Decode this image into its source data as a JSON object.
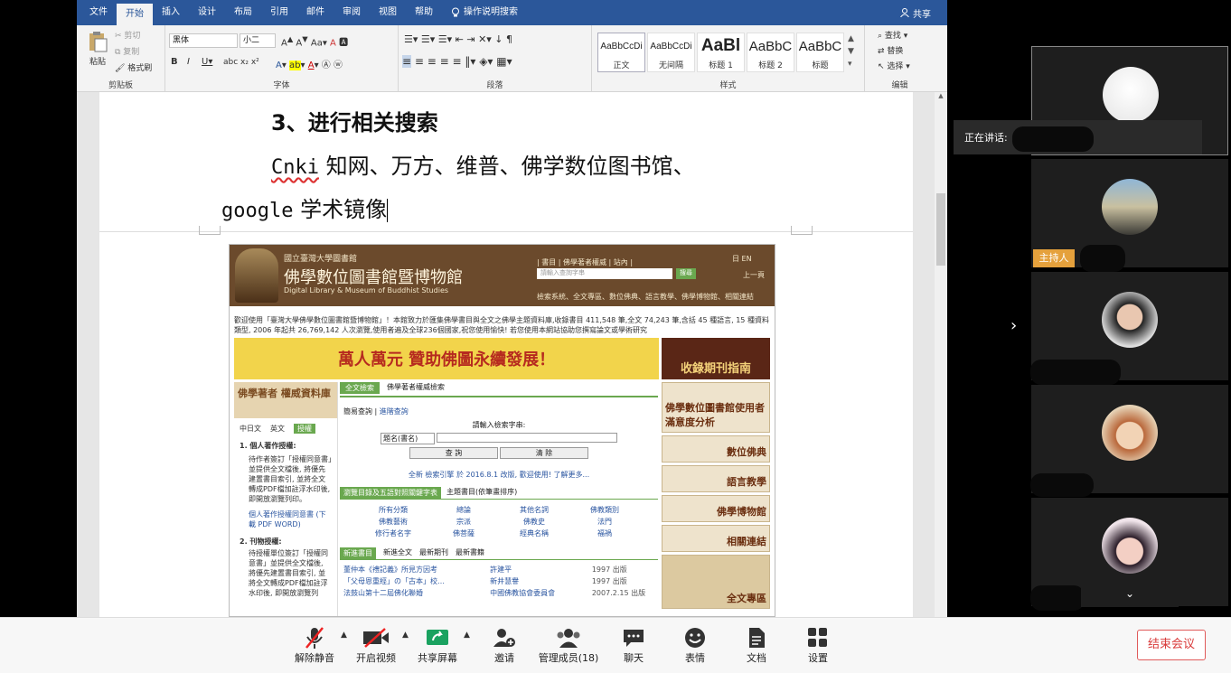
{
  "word": {
    "tabs": [
      "文件",
      "开始",
      "插入",
      "设计",
      "布局",
      "引用",
      "邮件",
      "审阅",
      "视图",
      "帮助"
    ],
    "active_tab": "开始",
    "tell_me": "操作说明搜索",
    "share": "共享",
    "clipboard": {
      "paste": "粘贴",
      "cut": "剪切",
      "copy": "复制",
      "format_painter": "格式刷",
      "label": "剪贴板"
    },
    "font": {
      "name": "黑体",
      "size": "小二",
      "label": "字体"
    },
    "paragraph_label": "段落",
    "styles": {
      "label": "样式",
      "items": [
        {
          "preview": "AaBbCcDi",
          "name": "正文"
        },
        {
          "preview": "AaBbCcDi",
          "name": "无间隔"
        },
        {
          "preview": "AaBl",
          "name": "标题 1"
        },
        {
          "preview": "AaBbC",
          "name": "标题 2"
        },
        {
          "preview": "AaBbC",
          "name": "标题"
        }
      ]
    },
    "editing": {
      "find": "查找",
      "replace": "替换",
      "select": "选择",
      "label": "编辑"
    }
  },
  "doc": {
    "line1": "3、进行相关搜索",
    "line2_a": "Cnki",
    "line2_b": "知网、万方、维普、佛学数位图书馆、",
    "line3_a": "google",
    "line3_b": "学术镜像"
  },
  "embedded": {
    "site_title": "佛學數位圖書館暨博物館",
    "site_sub_cn": "國立臺灣大學圖書館",
    "site_sub_en": "Digital Library & Museum of Buddhist Studies",
    "top_links": "| 書目 | 佛學著者權威 | 站內 |",
    "search_placeholder": "請輸入查詢字串",
    "search_btn": "搜尋",
    "prev": "上一頁",
    "lang": [
      "日",
      "EN"
    ],
    "nav": "檢索系統、全文專區、數位佛典、語言教學、佛學博物館、相關連結",
    "notice": "歡迎使用「臺灣大學佛學數位圖書館暨博物館」！本館致力於匯集佛學書目與全文之佛學主題資料庫,收錄書目 411,548 筆,全文 74,243 筆,含括 45 種語言, 15 種資料類型, 2006 年起共 26,769,142 人次瀏覽,使用者遍及全球236個國家,祝您使用愉快! 若您使用本網站協助您撰寫論文或學術研究",
    "banner": "萬人萬元 贊助佛圖永續發展！",
    "banner_right": "收錄期刊指南",
    "left_title": "佛學著者 權威資料庫",
    "left_tabs": [
      "中日文",
      "英文",
      "授權"
    ],
    "left_h1": "1. 個人著作授權:",
    "left_p1": "待作者簽訂「授權同意書」並提供全文檔後, 將優先建置書目索引, 並將全文轉成PDF檔加註浮水印後, 即開放瀏覽列印。",
    "left_link": "個人著作授權同意書 (下載 PDF WORD)",
    "left_h2": "2. 刊物授權:",
    "left_p2": "待授權單位簽訂「授權同意書」並提供全文檔後, 將優先建置書目索引, 並將全文轉成PDF檔加註浮水印後, 即開放瀏覽列",
    "mid_tabs": [
      "全文檢索",
      "佛學著者權威檢索"
    ],
    "mid_query": [
      "簡易查詢",
      "進階查詢"
    ],
    "mid_prompt": "請輸入檢索字串:",
    "mid_field": "題名(書名)",
    "mid_btns": [
      "查 詢",
      "清 除"
    ],
    "mid_new": "全新 檢索引擎 於 2016.8.1 改版, 歡迎使用! 了解更多...",
    "mid_tabs2": [
      "瀏覽目錄及五語對照關鍵字表",
      "主題書目(依筆畫排序)"
    ],
    "mid_cats": [
      "所有分類",
      "總論",
      "其他名詞",
      "佛教類別",
      "佛教藝術",
      "宗派",
      "佛教史",
      "法門",
      "修行者名字",
      "佛菩薩",
      "經典名稱",
      "福禍"
    ],
    "mid_tabs3": [
      "新進書目",
      "新進全文",
      "最新期刊",
      "最新書籍"
    ],
    "mid_rows": [
      {
        "t": "董仲本《禮記義》所見方因考",
        "a": "許建平",
        "y": "1997 出版"
      },
      {
        "t": "「父母恩重經」の「古本」校…",
        "a": "新井慧譽",
        "y": "1997 出版"
      },
      {
        "t": "法鼓山第十二屆佛化聯婚",
        "a": "中國佛教協會委員會",
        "y": "2007.2.15 出版"
      }
    ],
    "right_boxes": [
      "佛學數位圖書館使用者滿意度分析",
      "數位佛典",
      "語言教學",
      "佛學博物館",
      "相關連結",
      "全文專區"
    ]
  },
  "zoom": {
    "speaking": "正在讲话: ",
    "host_badge": "主持人",
    "toolbar": [
      {
        "icon": "mic-muted-icon",
        "label": "解除静音"
      },
      {
        "icon": "video-off-icon",
        "label": "开启视频"
      },
      {
        "icon": "share-screen-icon",
        "label": "共享屏幕"
      },
      {
        "icon": "invite-icon",
        "label": "邀请"
      },
      {
        "icon": "members-icon",
        "label": "管理成员(18)"
      },
      {
        "icon": "chat-icon",
        "label": "聊天"
      },
      {
        "icon": "emoji-icon",
        "label": "表情"
      },
      {
        "icon": "doc-icon",
        "label": "文档"
      },
      {
        "icon": "settings-icon",
        "label": "设置"
      }
    ],
    "end": "结束会议"
  },
  "colors": {
    "word_blue": "#2b579a",
    "zoom_bg": "#000000",
    "host": "#e5a13c",
    "end": "#d93a3a"
  }
}
